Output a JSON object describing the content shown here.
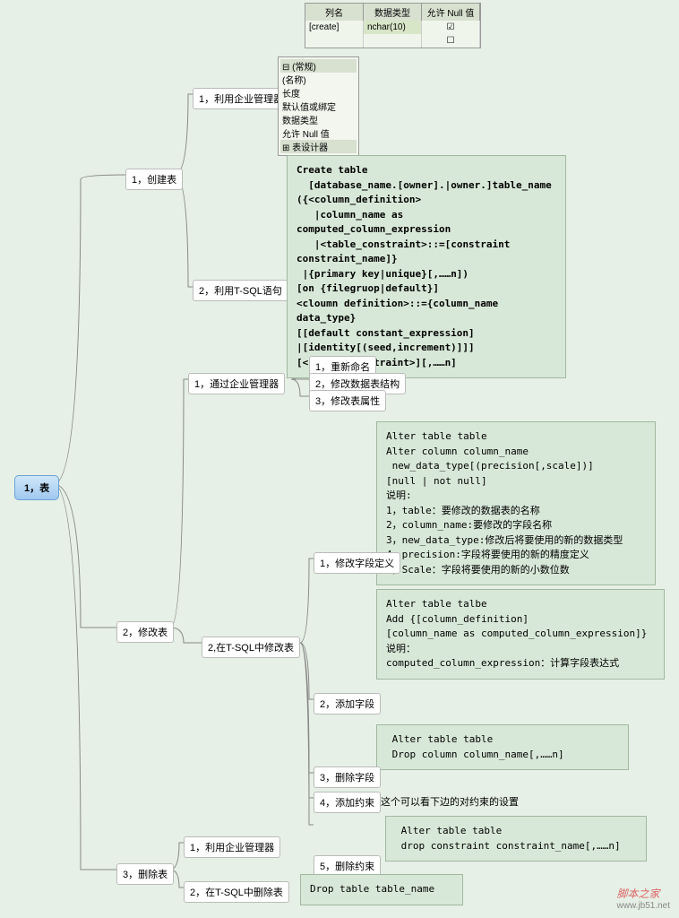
{
  "root": "1，表",
  "branch1": {
    "label": "1，创建表",
    "c1": "1，利用企业管理器",
    "c2": "2，利用T-SQL语句"
  },
  "branch2": {
    "label": "2，修改表",
    "c1": "1，通过企业管理器",
    "c2": "2,在T-SQL中修改表"
  },
  "branch3": {
    "label": "3，删除表",
    "c1": "1，利用企业管理器",
    "c2": "2，在T-SQL中删除表"
  },
  "b1c1_sub": [
    "1，重新命名",
    "2，修改数据表结构",
    "3，修改表属性"
  ],
  "b2c2_sub": {
    "s1": "1，修改字段定义",
    "s2": "2，添加字段",
    "s3": "3，删除字段",
    "s4": "4，添加约束",
    "s5": "5，删除约束"
  },
  "table": {
    "headers": [
      "列名",
      "数据类型",
      "允许 Null 值"
    ],
    "row": [
      "[create]",
      "nchar(10)",
      "☑"
    ]
  },
  "props": {
    "h1": "(常规)",
    "items": [
      "(名称)",
      "长度",
      "默认值或绑定",
      "数据类型",
      "允许 Null 值"
    ],
    "h2": "表设计器"
  },
  "code_create": "Create table\n  [database_name.[owner].|owner.]table_name\n({<column_definition>\n   |column_name as computed_column_expression\n   |<table_constraint>::=[constraint constraint_name]}\n |{primary key|unique}[,……n])\n[on {filegruop|default}]\n<cloumn definition>::={column_name data_type}\n[[default constant_expression]\n|[identity[(seed,increment)]]]\n[<column_constraint>][,……n]",
  "code_alter1": "Alter table table\nAlter column column_name\n new_data_type[(precision[,scale])]\n[null | not null]\n说明:\n1，table：要修改的数据表的名称\n2，column_name:要修改的字段名称\n3，new_data_type:修改后将要使用的新的数据类型\n4，precision:字段将要使用的新的精度定义\n5，Scale：字段将要使用的新的小数位数",
  "code_alter2": "Alter table talbe\nAdd {[column_definition]\n[column_name as computed_column_expression]}\n说明：\ncomputed_column_expression：计算字段表达式",
  "code_alter3": " Alter table table\n Drop column column_name[,……n]",
  "note_constraint": "这个可以看下边的对约束的设置",
  "code_alter5": " Alter table table\n drop constraint constraint_name[,……n]",
  "code_drop": "Drop table table_name",
  "watermark": {
    "name": "脚本之家",
    "url": "www.jb51.net"
  }
}
